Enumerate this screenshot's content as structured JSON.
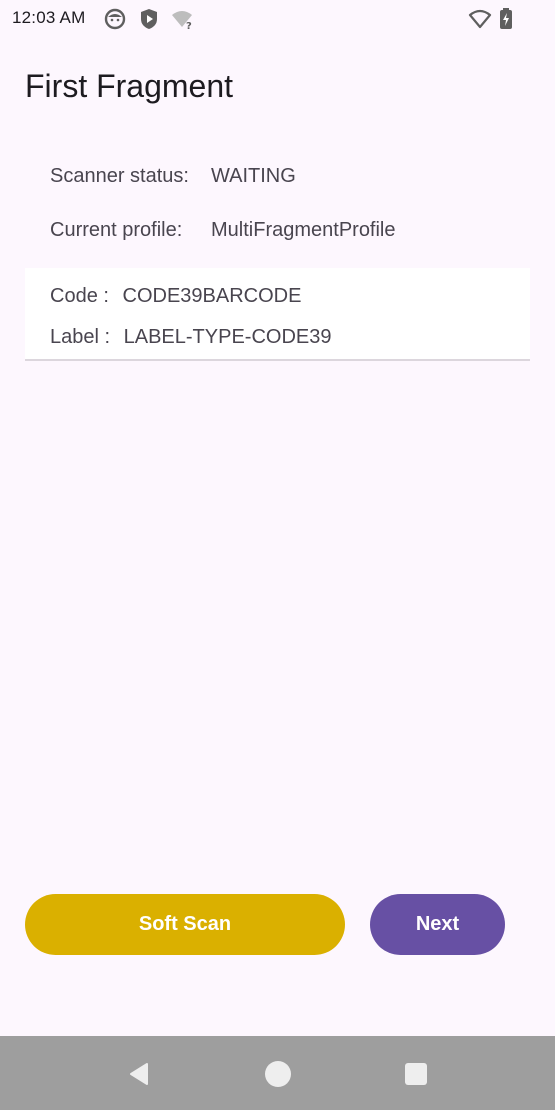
{
  "status_bar": {
    "time": "12:03 AM",
    "icons": [
      "face-icon",
      "shield-icon",
      "wifi-unknown-icon",
      "wifi-icon",
      "battery-icon"
    ]
  },
  "page": {
    "title": "First Fragment"
  },
  "info": {
    "scanner_status_label": "Scanner status:",
    "scanner_status_value": "WAITING",
    "current_profile_label": "Current profile:",
    "current_profile_value": "MultiFragmentProfile"
  },
  "scan_result": {
    "code_label": "Code :",
    "code_value": "CODE39BARCODE",
    "label_label": "Label :",
    "label_value": "LABEL-TYPE-CODE39"
  },
  "buttons": {
    "soft_scan": "Soft Scan",
    "next": "Next"
  },
  "colors": {
    "background": "#fdf7fe",
    "soft_scan_button": "#dab000",
    "next_button": "#6750a4",
    "nav_bar": "#9e9e9e"
  },
  "nav_bar": {
    "icons": [
      "back-icon",
      "home-icon",
      "recents-icon"
    ]
  }
}
